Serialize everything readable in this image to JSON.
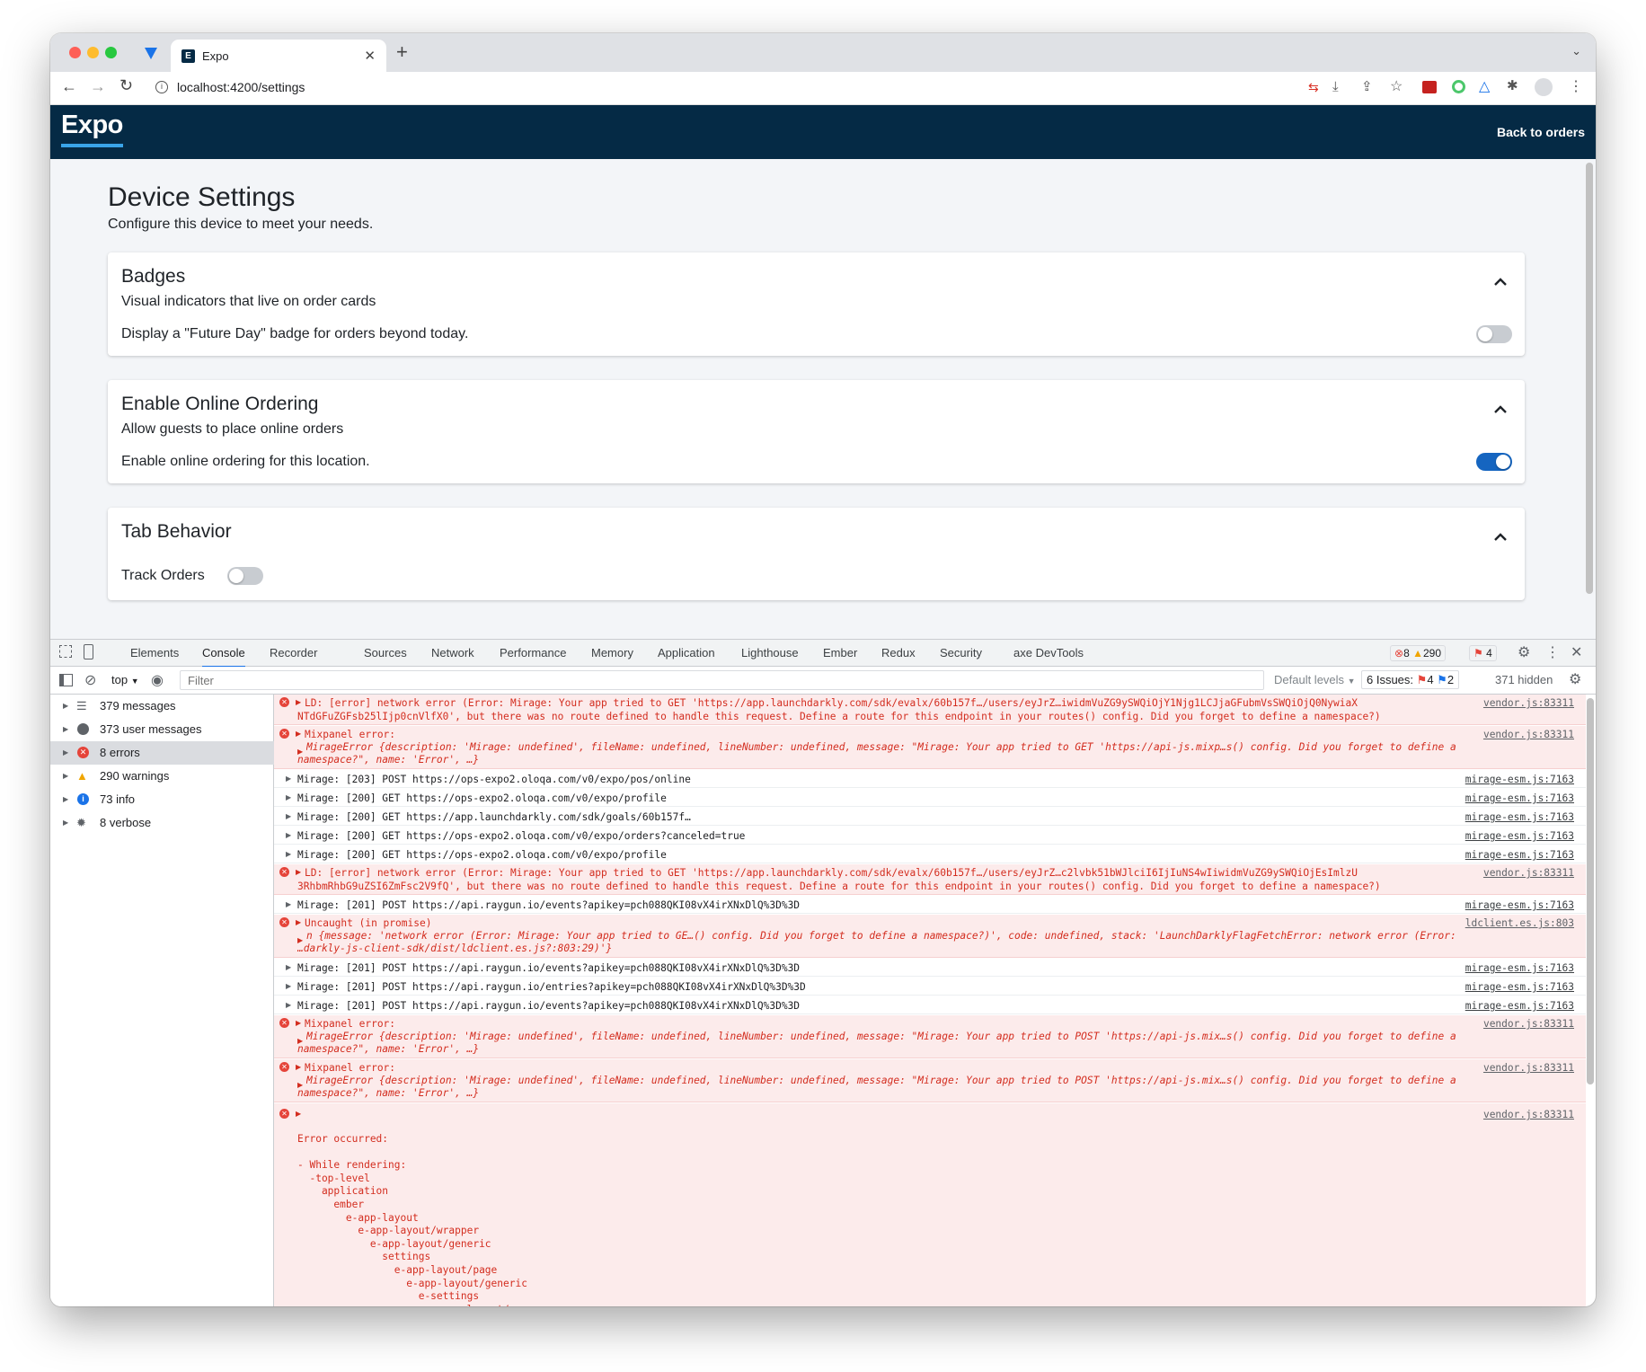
{
  "browser": {
    "tab_title": "Expo",
    "tab_favicon_letter": "E",
    "url": "localhost:4200/settings"
  },
  "app": {
    "logo": "Expo",
    "back_link": "Back to orders"
  },
  "page": {
    "title": "Device Settings",
    "subtitle": "Configure this device to meet your needs."
  },
  "sections": [
    {
      "title": "Badges",
      "subtitle": "Visual indicators that live on order cards",
      "setting": "Display a \"Future Day\" badge for orders beyond today.",
      "enabled": false
    },
    {
      "title": "Enable Online Ordering",
      "subtitle": "Allow guests to place online orders",
      "setting": "Enable online ordering for this location.",
      "enabled": true
    },
    {
      "title": "Tab Behavior",
      "setting": "Track Orders",
      "enabled": false
    }
  ],
  "devtools": {
    "tabs": [
      "Elements",
      "Console",
      "Recorder",
      "Sources",
      "Network",
      "Performance",
      "Memory",
      "Application",
      "Lighthouse",
      "Ember",
      "Redux",
      "Security",
      "axe DevTools"
    ],
    "active_tab": "Console",
    "error_count": "8",
    "warning_count": "290",
    "issue_count": "4",
    "context": "top",
    "filter_placeholder": "Filter",
    "levels": "Default levels",
    "issues_label": "6 Issues:",
    "issues_errors": "4",
    "issues_info": "2",
    "hidden": "371 hidden",
    "sidebar": [
      {
        "label": "379 messages",
        "icon": "list-icon"
      },
      {
        "label": "373 user messages",
        "icon": "user-icon"
      },
      {
        "label": "8 errors",
        "icon": "error-icon"
      },
      {
        "label": "290 warnings",
        "icon": "warning-icon"
      },
      {
        "label": "73 info",
        "icon": "info-icon"
      },
      {
        "label": "8 verbose",
        "icon": "bug-icon"
      }
    ]
  },
  "console": {
    "l1": "LD: [error] network error (Error: Mirage: Your app tried to GET 'https://app.launchdarkly.com/sdk/evalx/60b157f…/users/eyJrZ…iwidmVuZG9ySWQiOjY1Njg1LCJjaGFubmVsSWQiOjQ0NywiaX",
    "l1b": "NTdGFuZGFsb25lIjp0cnVlfX0', but there was no route defined to handle this request. Define a route for this endpoint in your routes() config. Did you forget to define a namespace?)",
    "l2": "Mixpanel error:",
    "l2b": "MirageError {description: 'Mirage: undefined', fileName: undefined, lineNumber: undefined, message: \"Mirage: Your app tried to GET 'https://api-js.mixp…s() config. Did you forget to define a",
    "l2c": "namespace?\", name: 'Error', …}",
    "l3": "Mirage: [203] POST https://ops-expo2.oloqa.com/v0/expo/pos/online",
    "l4": "Mirage: [200] GET https://ops-expo2.oloqa.com/v0/expo/profile",
    "l5": "Mirage: [200] GET https://app.launchdarkly.com/sdk/goals/60b157f…",
    "l6": "Mirage: [200] GET https://ops-expo2.oloqa.com/v0/expo/orders?canceled=true",
    "l7": "Mirage: [200] GET https://ops-expo2.oloqa.com/v0/expo/profile",
    "l8": "LD: [error] network error (Error: Mirage: Your app tried to GET 'https://app.launchdarkly.com/sdk/evalx/60b157f…/users/eyJrZ…c2lvbk51bWJlciI6IjIuNS4wIiwidmVuZG9ySWQiOjEsImlzU",
    "l8b": "3RhbmRhbG9uZSI6ZmFsc2V9fQ', but there was no route defined to handle this request. Define a route for this endpoint in your routes() config. Did you forget to define a namespace?)",
    "l9": "Mirage: [201] POST https://api.raygun.io/events?apikey=pch088QKI08vX4irXNxDlQ%3D%3D",
    "l10": "Uncaught (in promise)",
    "l10b": "n {message: 'network error (Error: Mirage: Your app tried to GE…() config. Did you forget to define a namespace?)', code: undefined, stack: 'LaunchDarklyFlagFetchError: network error (Error:",
    "l10c": "…darkly-js-client-sdk/dist/ldclient.es.js?:803:29)'}",
    "l11": "Mirage: [201] POST https://api.raygun.io/events?apikey=pch088QKI08vX4irXNxDlQ%3D%3D",
    "l12": "Mirage: [201] POST https://api.raygun.io/entries?apikey=pch088QKI08vX4irXNxDlQ%3D%3D",
    "l13": "Mirage: [201] POST https://api.raygun.io/events?apikey=pch088QKI08vX4irXNxDlQ%3D%3D",
    "l14": "Mixpanel error:",
    "l14b": "MirageError {description: 'Mirage: undefined', fileName: undefined, lineNumber: undefined, message: \"Mirage: Your app tried to POST 'https://api-js.mix…s() config. Did you forget to define a",
    "l14c": "namespace?\", name: 'Error', …}",
    "l15": "Mixpanel error:",
    "l15b": "MirageError {description: 'Mirage: undefined', fileName: undefined, lineNumber: undefined, message: \"Mirage: Your app tried to POST 'https://api-js.mix…s() config. Did you forget to define a",
    "l15c": "namespace?\", name: 'Error', …}",
    "stack": "Error occurred:\n\n- While rendering:\n  -top-level\n    application\n      ember\n        e-app-layout\n          e-app-layout/wrapper\n            e-app-layout/generic\n              settings\n                e-app-layout/page\n                  e-app-layout/generic\n                    e-settings\n                      e-app-layout/page\n                        e-app-layout/generic",
    "src_vendor": "vendor.js:83311",
    "src_mirage": "mirage-esm.js:7163",
    "src_ld": "ldclient.es.js:803"
  }
}
